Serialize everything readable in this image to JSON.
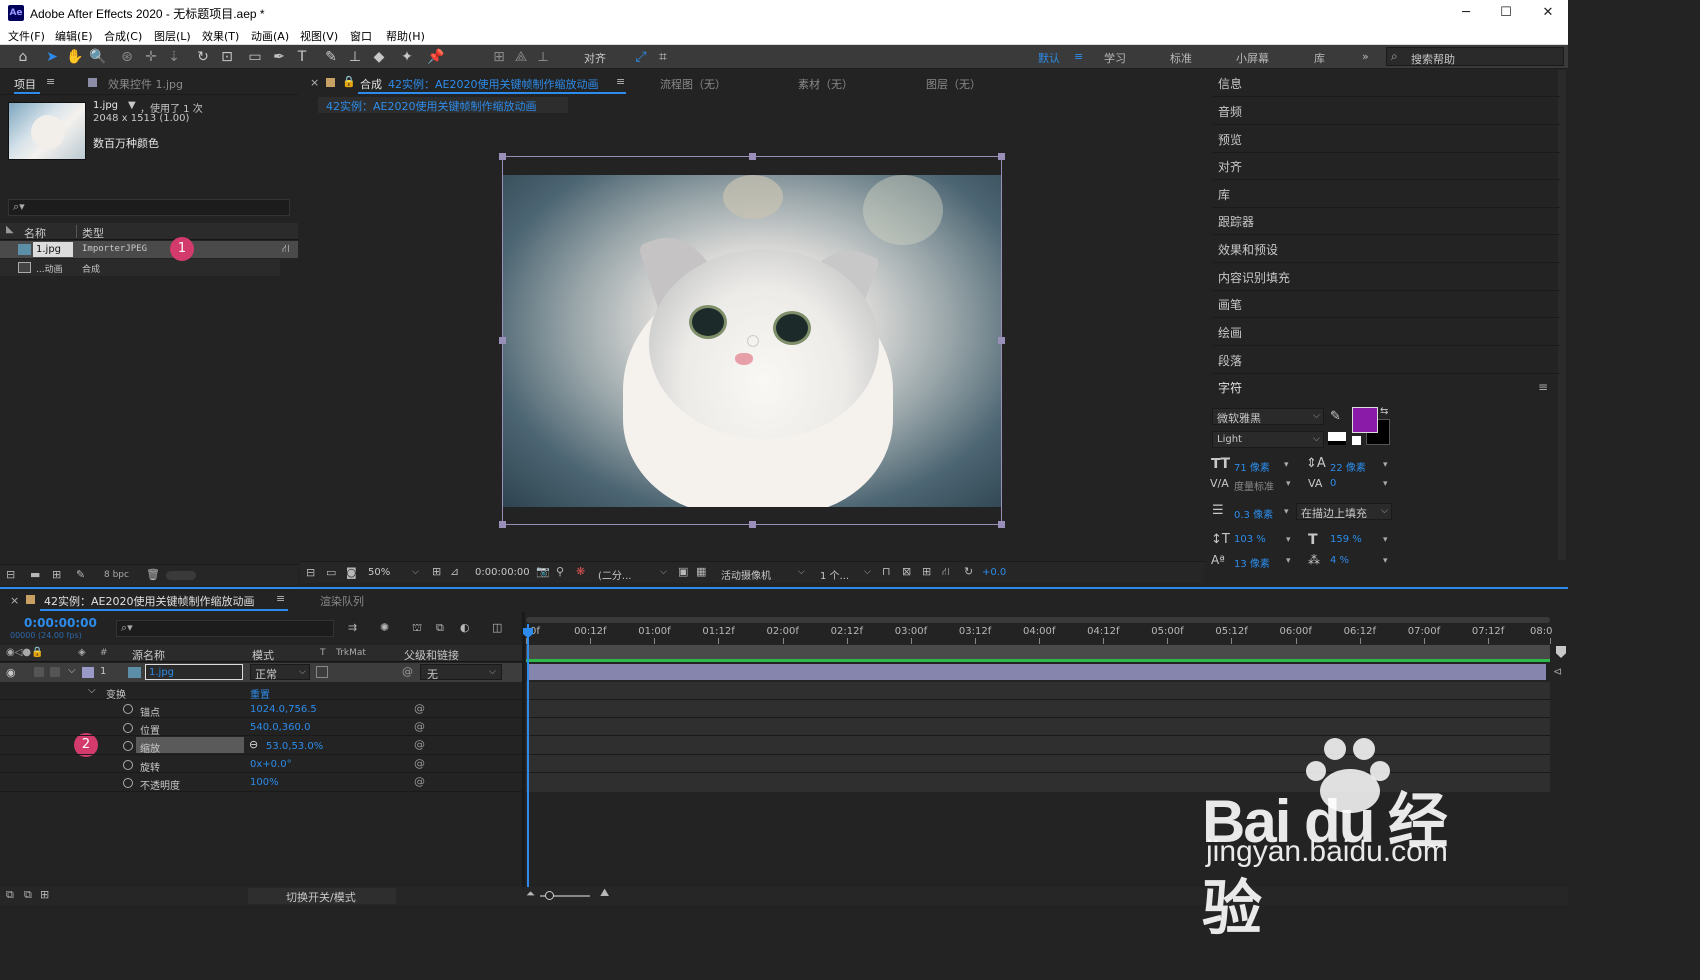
{
  "window": {
    "title": "Adobe After Effects 2020 - 无标题项目.aep *",
    "app_icon": "Ae"
  },
  "menu": [
    "文件(F)",
    "编辑(E)",
    "合成(C)",
    "图层(L)",
    "效果(T)",
    "动画(A)",
    "视图(V)",
    "窗口",
    "帮助(H)"
  ],
  "toolbar": {
    "align_label": "对齐",
    "workspaces": [
      "默认",
      "学习",
      "标准",
      "小屏幕",
      "库"
    ],
    "search_placeholder": "搜索帮助"
  },
  "project_panel": {
    "tab_project": "项目",
    "tab_effects": "效果控件 1.jpg",
    "file_name": "1.jpg",
    "file_usage": "，使用了 1 次",
    "file_dims": "2048 x 1513 (1.00)",
    "file_colors": "数百万种颜色",
    "col_name": "名称",
    "col_type": "类型",
    "items": [
      {
        "name": "1.jpg",
        "type": "ImporterJPEG"
      },
      {
        "name": "...动画",
        "type": "合成"
      }
    ],
    "bpc": "8 bpc"
  },
  "comp_panel": {
    "tab_label": "合成",
    "comp_name": "42实例：AE2020使用关键帧制作缩放动画",
    "flowchart": "流程图（无）",
    "footage": "素材（无）",
    "layer": "图层（无）",
    "breadcrumb": "42实例：AE2020使用关键帧制作缩放动画",
    "zoom": "50%",
    "timecode": "0:00:00:00",
    "resolution": "(二分...",
    "camera": "活动摄像机",
    "views": "1 个...",
    "exposure": "+0.0"
  },
  "right_panel": {
    "items": [
      "信息",
      "音频",
      "预览",
      "对齐",
      "库",
      "跟踪器",
      "效果和预设",
      "内容识别填充",
      "画笔",
      "绘画",
      "段落"
    ],
    "character_title": "字符",
    "font_family": "微软雅黑",
    "font_style": "Light",
    "font_size": "71 像素",
    "leading": "22 像素",
    "kerning": "度量标准",
    "tracking": "0",
    "stroke_width": "0.3 像素",
    "stroke_mode": "在描边上填充",
    "vert_scale": "103 %",
    "horiz_scale": "159 %",
    "baseline": "13 像素",
    "tsume": "4 %",
    "fill_color": "#8a1aa8"
  },
  "timeline": {
    "tab_comp": "42实例：AE2020使用关键帧制作缩放动画",
    "tab_render": "渲染队列",
    "timecode": "0:00:00:00",
    "frame_info": "00000 (24.00 fps)",
    "col_source": "源名称",
    "col_mode": "模式",
    "col_t": "T",
    "col_trkmat": "TrkMat",
    "col_parent": "父级和链接",
    "layer_num": "1",
    "layer_name": "1.jpg",
    "layer_mode": "正常",
    "layer_parent": "无",
    "transform": "变换",
    "reset": "重置",
    "props": [
      {
        "name": "锚点",
        "value": "1024.0,756.5"
      },
      {
        "name": "位置",
        "value": "540.0,360.0"
      },
      {
        "name": "缩放",
        "value": "53.0,53.0%"
      },
      {
        "name": "旋转",
        "value": "0x+0.0°"
      },
      {
        "name": "不透明度",
        "value": "100%"
      }
    ],
    "ticks": [
      "0f",
      "00:12f",
      "01:00f",
      "01:12f",
      "02:00f",
      "02:12f",
      "03:00f",
      "03:12f",
      "04:00f",
      "04:12f",
      "05:00f",
      "05:12f",
      "06:00f",
      "06:12f",
      "07:00f",
      "07:12f",
      "08:0"
    ],
    "toggle_label": "切换开关/模式"
  },
  "annotations": [
    "1",
    "2"
  ],
  "watermark": {
    "brand": "Bai du 经验",
    "url": "jingyan.baidu.com"
  }
}
